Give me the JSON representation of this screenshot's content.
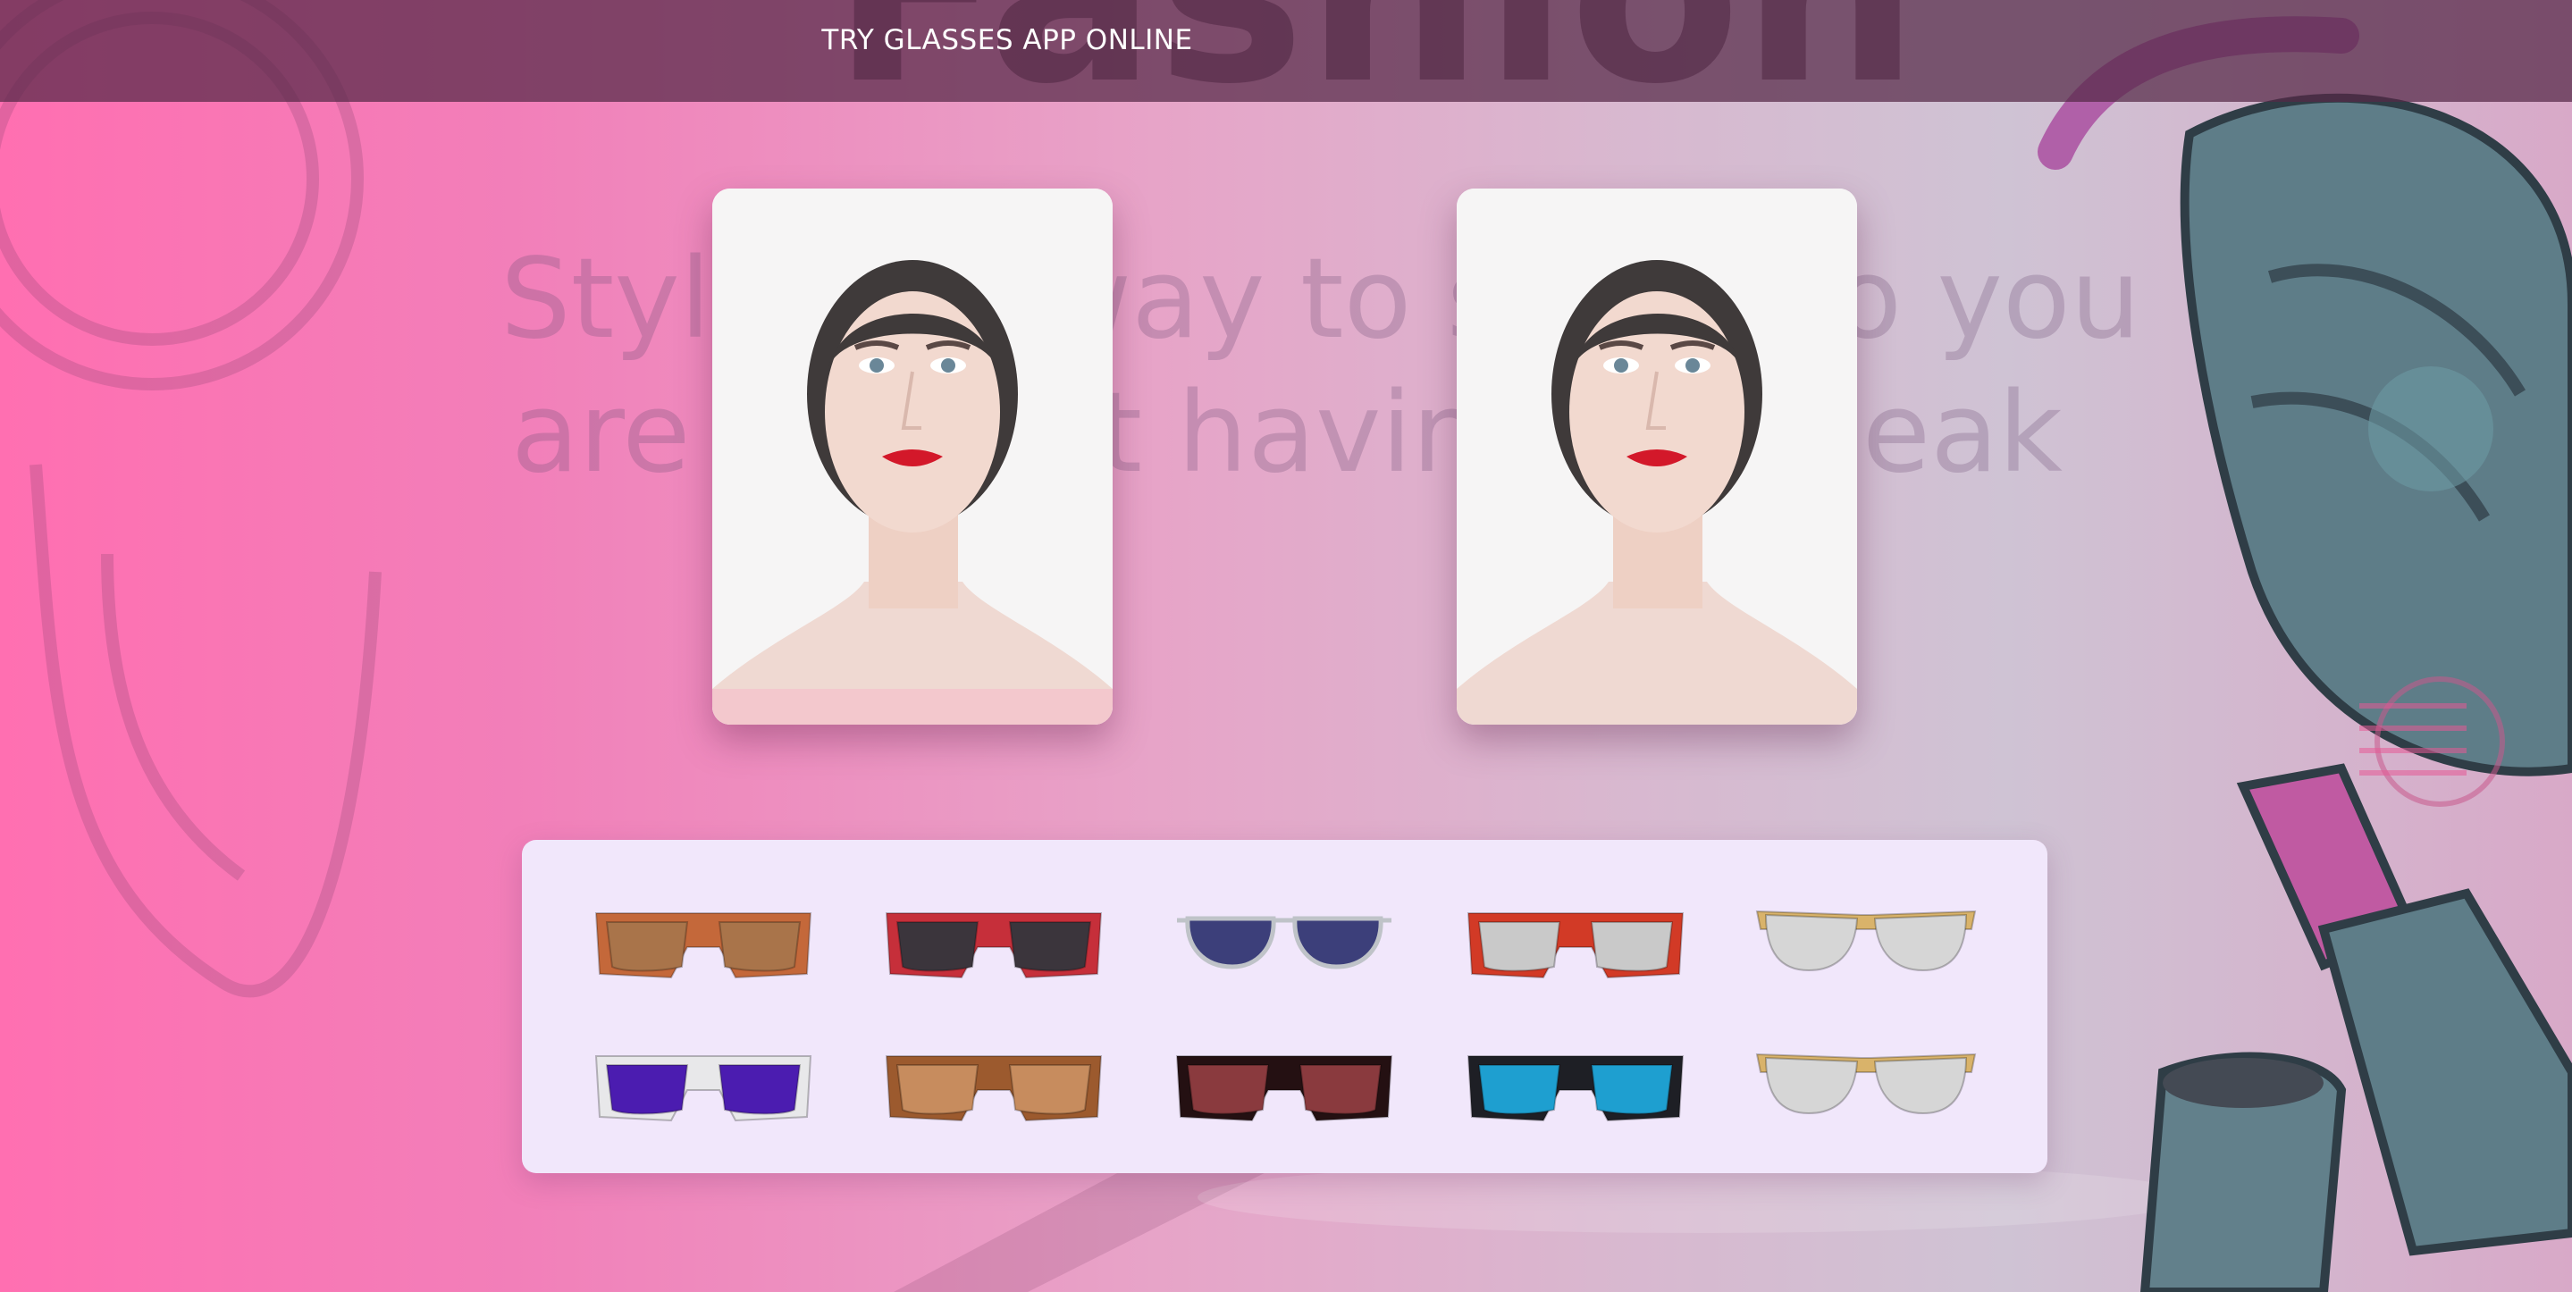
{
  "header": {
    "title": "TRY GLASSES APP ONLINE"
  },
  "background": {
    "watermark_top": "Fashion",
    "watermark_lines": "Style is a way to say who you\nare without having to speak"
  },
  "photos": {
    "left": {
      "label": "Woman portrait"
    },
    "right": {
      "label": "Woman portrait"
    }
  },
  "glasses": [
    {
      "name": "brown-wayfarer-glasses-icon",
      "frame": "#c4683a",
      "lens": "#a9744a"
    },
    {
      "name": "american-flag-glasses-icon",
      "frame": "#c62f3a",
      "lens": "#3b353c"
    },
    {
      "name": "navy-aviator-glasses-icon",
      "frame": "#bfc3c8",
      "lens": "#3c3f7a"
    },
    {
      "name": "red-star-glasses-icon",
      "frame": "#d23a26",
      "lens": "#c9c9c9"
    },
    {
      "name": "gold-cateye-glasses-icon",
      "frame": "#d9b36a",
      "lens": "#d6d6d6"
    },
    {
      "name": "white-purple-glasses-icon",
      "frame": "#e8e8ea",
      "lens": "#4b1cb0"
    },
    {
      "name": "tortoise-glasses-icon",
      "frame": "#9c5a2e",
      "lens": "#c78c5e"
    },
    {
      "name": "burgundy-mirror-glasses-icon",
      "frame": "#241012",
      "lens": "#8a3a3e"
    },
    {
      "name": "black-blue-glasses-icon",
      "frame": "#1e1f25",
      "lens": "#1e9fd0"
    },
    {
      "name": "gold-clear-glasses-icon",
      "frame": "#d9b36a",
      "lens": "#d6d6d6"
    }
  ]
}
